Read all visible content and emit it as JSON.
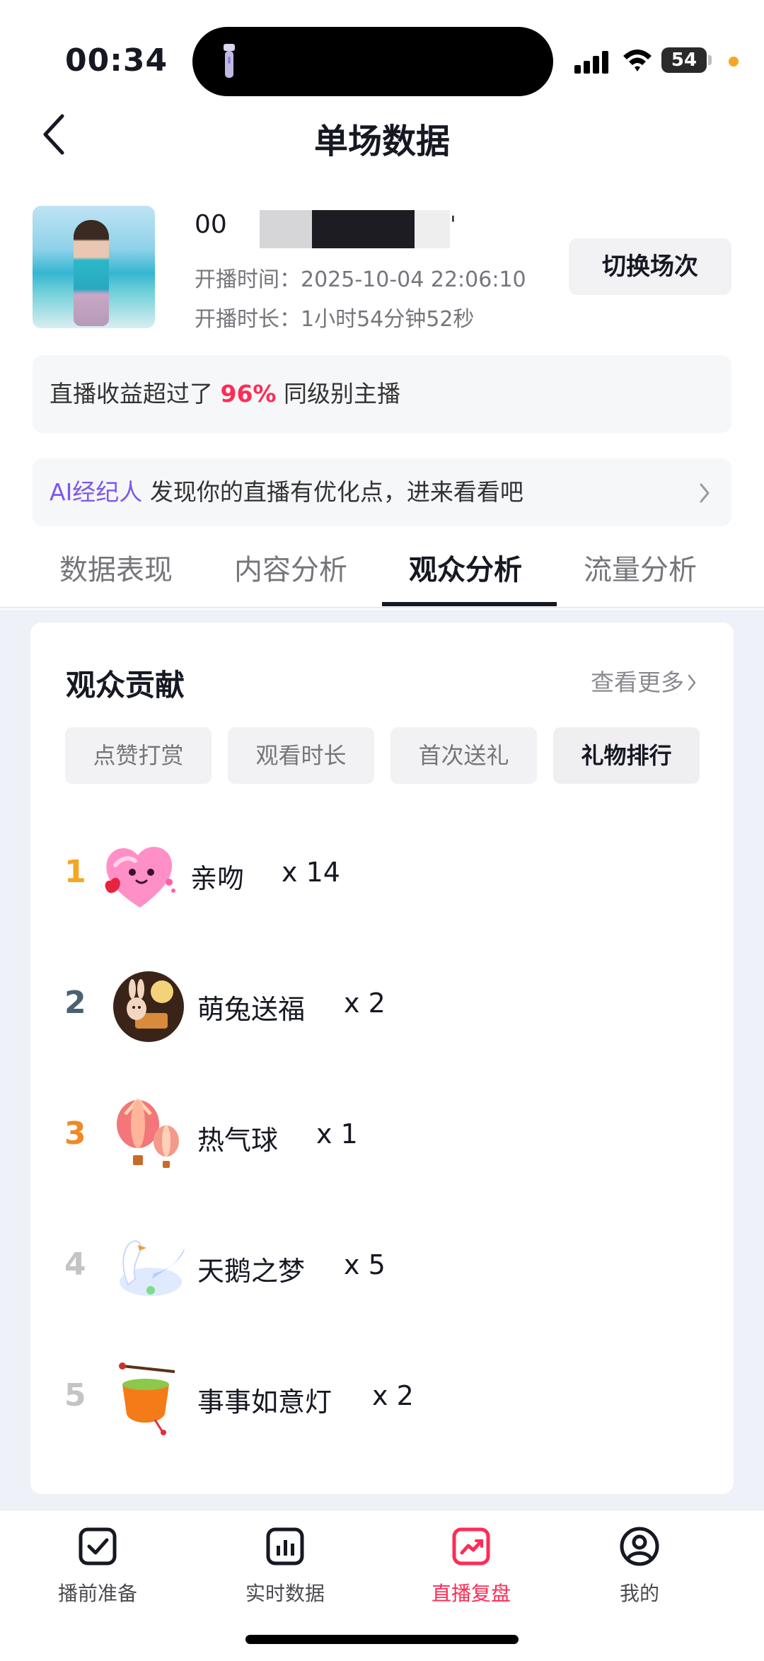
{
  "status": {
    "time": "00:34",
    "battery": "54"
  },
  "nav": {
    "title": "单场数据"
  },
  "profile": {
    "name": "00",
    "name_tail": "'",
    "start_time": "开播时间：2025-10-04 22:06:10",
    "duration": "开播时长：1小时54分钟52秒",
    "switch_label": "切换场次"
  },
  "earnings_banner": {
    "prefix": "直播收益超过了",
    "percent": "96%",
    "suffix": "同级别主播"
  },
  "ai_banner": {
    "tag": "AI经纪人",
    "text": "发现你的直播有优化点，进来看看吧"
  },
  "tabs": [
    "数据表现",
    "内容分析",
    "观众分析",
    "流量分析"
  ],
  "active_tab": "观众分析",
  "card": {
    "title": "观众贡献",
    "see_more": "查看更多",
    "chips": [
      "点赞打赏",
      "观看时长",
      "首次送礼",
      "礼物排行"
    ],
    "active_chip": "礼物排行",
    "gifts": [
      {
        "rank": "1",
        "name": "亲吻",
        "count": "x 14",
        "rank_color": "#f5a623",
        "icon": "kiss-heart-icon"
      },
      {
        "rank": "2",
        "name": "萌兔送福",
        "count": "x 2",
        "rank_color": "#4a6270",
        "icon": "rabbit-moon-icon"
      },
      {
        "rank": "3",
        "name": "热气球",
        "count": "x 1",
        "rank_color": "#f08a24",
        "icon": "hot-air-balloon-icon"
      },
      {
        "rank": "4",
        "name": "天鹅之梦",
        "count": "x 5",
        "rank_color": "#c4c4c6",
        "icon": "swan-icon"
      },
      {
        "rank": "5",
        "name": "事事如意灯",
        "count": "x 2",
        "rank_color": "#c4c4c6",
        "icon": "lantern-icon"
      }
    ]
  },
  "bottom_nav": [
    {
      "label": "播前准备",
      "icon": "checkbox-icon"
    },
    {
      "label": "实时数据",
      "icon": "bar-chart-icon"
    },
    {
      "label": "直播复盘",
      "icon": "trend-chart-icon"
    },
    {
      "label": "我的",
      "icon": "profile-icon"
    }
  ],
  "active_bottom": "直播复盘"
}
